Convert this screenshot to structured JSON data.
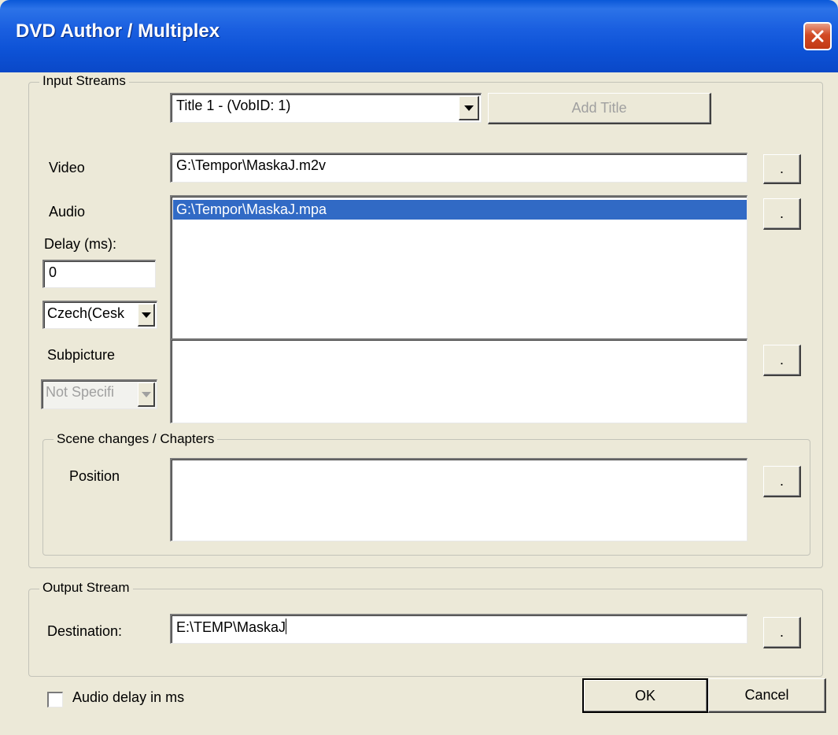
{
  "window": {
    "title": "DVD Author / Multiplex"
  },
  "input_streams": {
    "group_label": "Input Streams",
    "title_combo": {
      "value": "Title 1 - (VobID: 1)"
    },
    "add_title_label": "Add Title",
    "video": {
      "label": "Video",
      "value": "G:\\Tempor\\MaskaJ.m2v",
      "browse_label": "."
    },
    "audio": {
      "label": "Audio",
      "items": [
        "G:\\Tempor\\MaskaJ.mpa"
      ],
      "browse_label": ".",
      "delay_label": "Delay (ms):",
      "delay_value": "0",
      "language_value": "Czech(Cesk"
    },
    "subpicture": {
      "label": "Subpicture",
      "language_value": "Not Specifi",
      "browse_label": "."
    },
    "scene_changes": {
      "group_label": "Scene changes / Chapters",
      "position_label": "Position",
      "browse_label": "."
    }
  },
  "output_stream": {
    "group_label": "Output Stream",
    "destination_label": "Destination:",
    "destination_value": "E:\\TEMP\\MaskaJ",
    "browse_label": "."
  },
  "footer": {
    "audio_delay_checkbox_label": "Audio delay in ms",
    "audio_delay_checked": false,
    "ok_label": "OK",
    "cancel_label": "Cancel"
  },
  "colors": {
    "titlebar": "#0d52d6",
    "dialog_bg": "#ece9d8",
    "selection": "#316ac5",
    "close_button": "#d24a24"
  },
  "icons": {
    "close": "close-icon",
    "dropdown": "chevron-down-icon"
  }
}
